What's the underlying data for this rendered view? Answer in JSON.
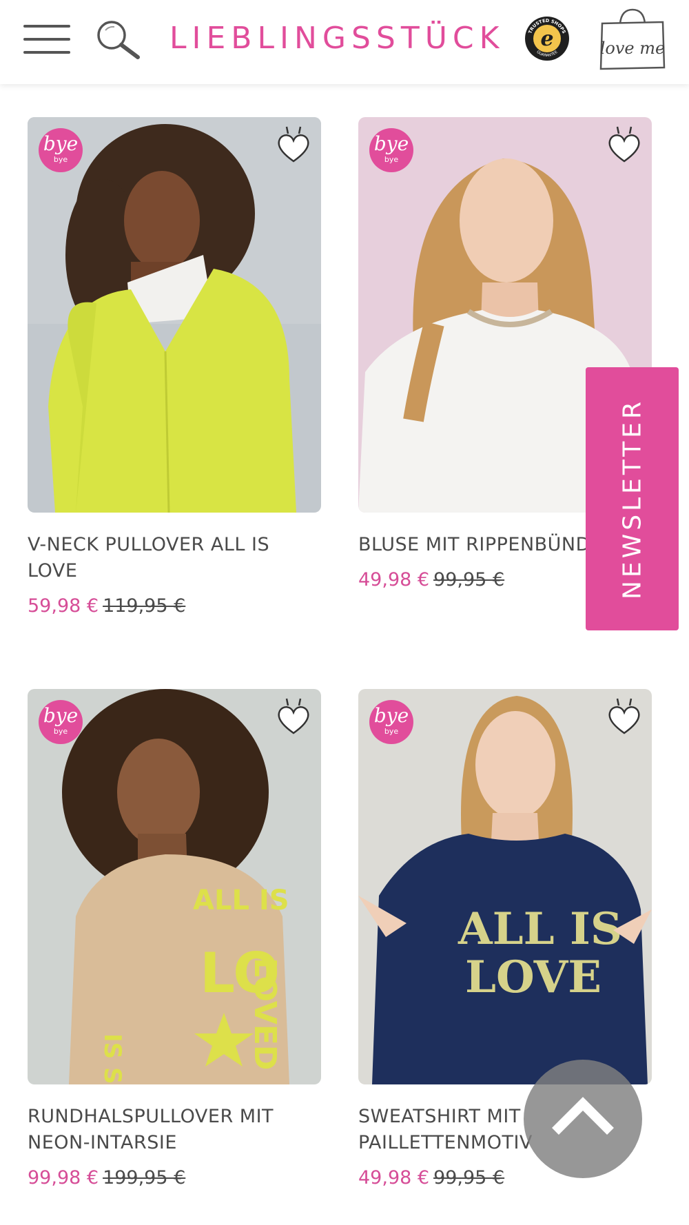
{
  "header": {
    "logo": "LIEBLINGSSTÜCK",
    "menu_icon": "hamburger-menu-icon",
    "search_icon": "search-icon",
    "trust_badge": {
      "top_text": "TRUSTED SHOPS",
      "letter": "e",
      "bottom_text": "GUARANTEE"
    },
    "bag_label": "love me"
  },
  "colors": {
    "accent": "#e14d9b",
    "price": "#d64d97",
    "text": "#4a4a4a"
  },
  "badge": {
    "script": "bye",
    "small": "bye"
  },
  "products": [
    {
      "title": "V-NECK PULLOVER ALL IS LOVE",
      "sale_price": "59,98 €",
      "old_price": "119,95 €",
      "image": "woman in lime v-neck pullover"
    },
    {
      "title": "BLUSE MIT RIPPENBÜND",
      "sale_price": "49,98 €",
      "old_price": "99,95 €",
      "image": "woman in white blouse"
    },
    {
      "title": "RUNDHALSPULLOVER MIT NEON-INTARSIE",
      "sale_price": "99,98 €",
      "old_price": "199,95 €",
      "image": "woman in beige pullover",
      "print": [
        "ALL IS",
        "LO",
        "LOVED",
        "IS SWE"
      ]
    },
    {
      "title": "SWEATSHIRT MIT PAILLETTENMOTIV",
      "sale_price": "49,98 €",
      "old_price": "99,95 €",
      "image": "woman in navy sweatshirt",
      "print": [
        "ALL IS",
        "LOVE"
      ]
    }
  ],
  "newsletter": "NEWSLETTER",
  "scroll_top_icon": "chevron-up-icon"
}
